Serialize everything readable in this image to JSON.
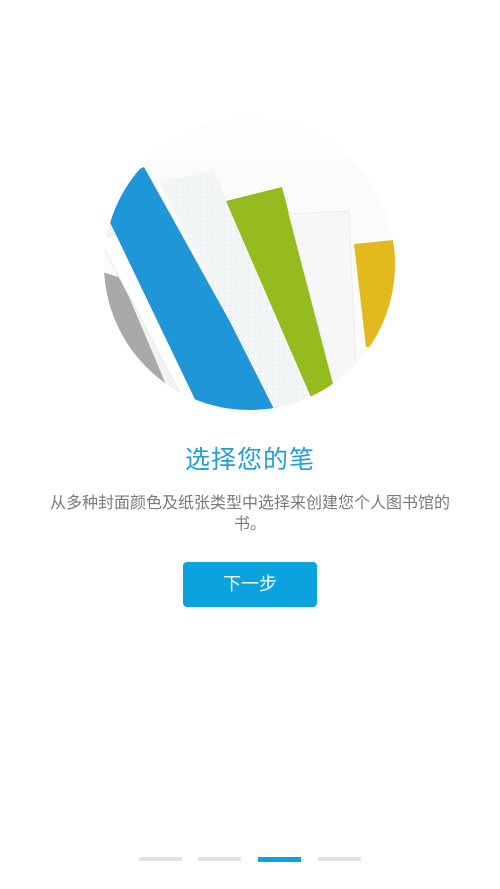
{
  "onboarding": {
    "title": "选择您的笔",
    "description": "从多种封面颜色及纸张类型中选择来创建您个人图书馆的书。",
    "next_button_label": "下一步"
  },
  "pager": {
    "total_pages": 4,
    "current_page": 3
  },
  "colors": {
    "accent": "#0aa3de",
    "title": "#1f9fd8",
    "description": "#7a7a7a",
    "cover_blue": "#1e96d8",
    "cover_green": "#95bb1e",
    "cover_yellow": "#e2b91f",
    "cover_gray": "#a9a9a9"
  }
}
